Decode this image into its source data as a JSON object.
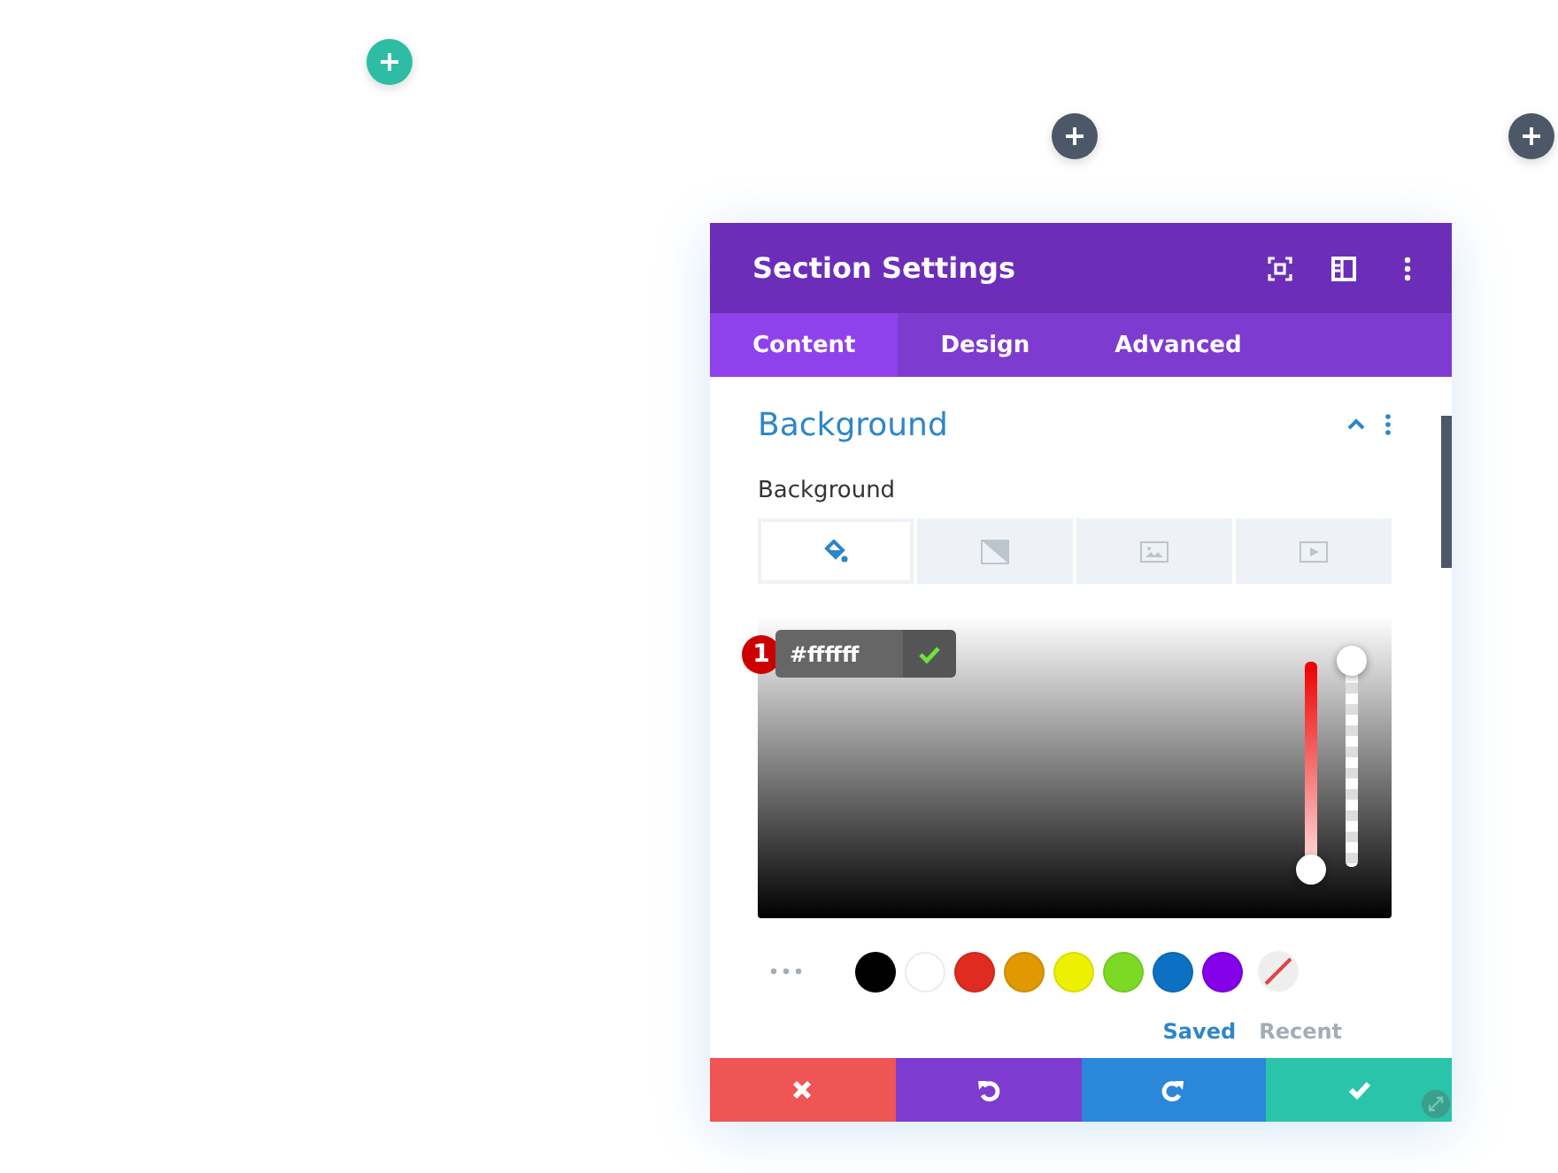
{
  "add_buttons": [
    {
      "color": "#2ebda4"
    },
    {
      "color": "#4c5767"
    },
    {
      "color": "#4c5767"
    }
  ],
  "modal": {
    "title": "Section Settings",
    "tabs": [
      {
        "label": "Content",
        "selected": true
      },
      {
        "label": "Design",
        "selected": false
      },
      {
        "label": "Advanced",
        "selected": false
      }
    ],
    "section": {
      "title": "Background",
      "expanded": true
    },
    "field_label": "Background",
    "background_types": [
      {
        "kind": "color",
        "selected": true
      },
      {
        "kind": "gradient",
        "selected": false
      },
      {
        "kind": "image",
        "selected": false
      },
      {
        "kind": "video",
        "selected": false
      }
    ],
    "color_picker": {
      "hex_value": "#ffffff",
      "badge": "1",
      "hue": {
        "level": 0
      },
      "alpha": {
        "level": 1
      },
      "swatches": [
        {
          "color": "#000000"
        },
        {
          "color": "#ffffff"
        },
        {
          "color": "#e02b20"
        },
        {
          "color": "#e09900"
        },
        {
          "color": "#edf000"
        },
        {
          "color": "#7cda24"
        },
        {
          "color": "#0c71c3"
        },
        {
          "color": "#8300e9"
        }
      ],
      "palette_tabs": [
        {
          "label": "Saved",
          "selected": true
        },
        {
          "label": "Recent",
          "selected": false
        }
      ]
    },
    "footer_buttons": [
      {
        "kind": "cancel",
        "color": "#ef5555"
      },
      {
        "kind": "undo",
        "color": "#7e3bd0"
      },
      {
        "kind": "redo",
        "color": "#2b87da"
      },
      {
        "kind": "save",
        "color": "#29c4a9"
      }
    ]
  }
}
